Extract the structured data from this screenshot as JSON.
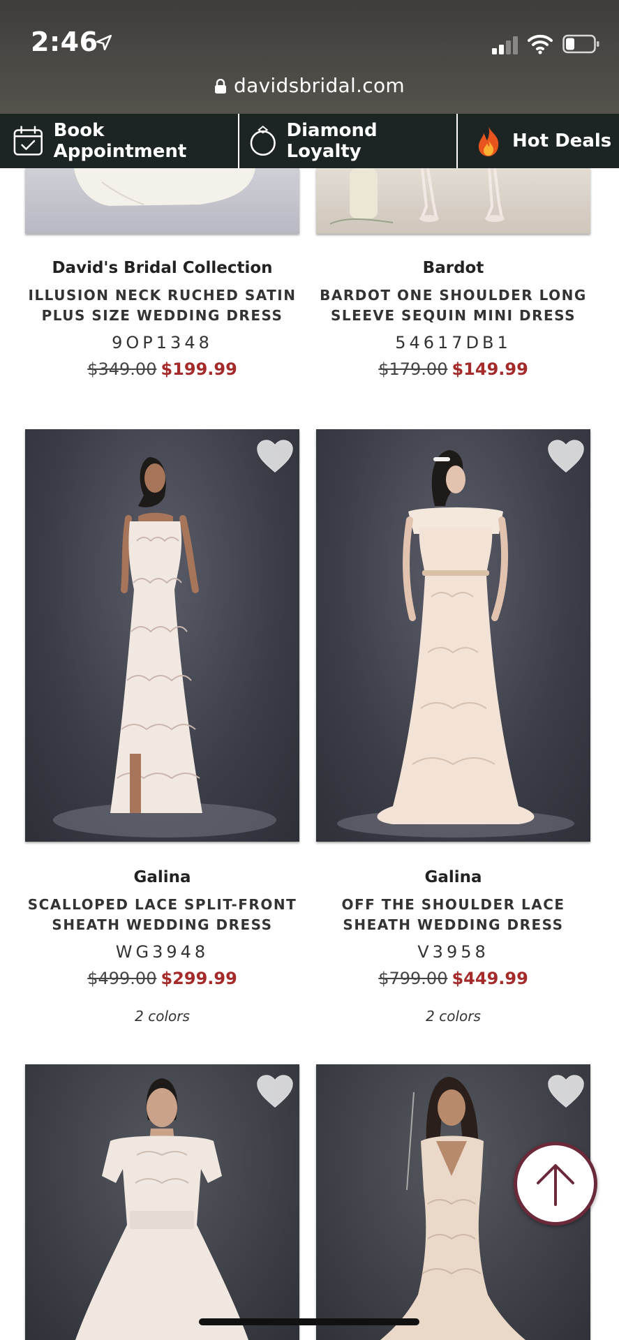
{
  "status_bar": {
    "time": "2:46",
    "url": "davidsbridal.com"
  },
  "nav": {
    "book_label": "Book Appointment",
    "diamond_label": "Diamond Loyalty",
    "deals_label": "Hot Deals"
  },
  "products": [
    {
      "brand": "David's Bridal Collection",
      "name": "ILLUSION NECK RUCHED SATIN PLUS SIZE WEDDING DRESS",
      "sku": "9OP1348",
      "old_price": "$349.00",
      "new_price": "$199.99"
    },
    {
      "brand": "Bardot",
      "name": "BARDOT ONE SHOULDER LONG SLEEVE SEQUIN MINI DRESS",
      "sku": "54617DB1",
      "old_price": "$179.00",
      "new_price": "$149.99"
    },
    {
      "brand": "Galina",
      "name": "SCALLOPED LACE SPLIT-FRONT SHEATH WEDDING DRESS",
      "sku": "WG3948",
      "old_price": "$499.00",
      "new_price": "$299.99",
      "colors": "2 colors"
    },
    {
      "brand": "Galina",
      "name": "OFF THE SHOULDER LACE SHEATH WEDDING DRESS",
      "sku": "V3958",
      "old_price": "$799.00",
      "new_price": "$449.99",
      "colors": "2 colors"
    }
  ],
  "icons": {
    "heart": "heart-icon",
    "back_to_top": "arrow-up-icon"
  },
  "colors": {
    "nav_bg": "#1c2424",
    "sale_price": "#a52a2a",
    "back_top_border": "#6b2a3a"
  }
}
